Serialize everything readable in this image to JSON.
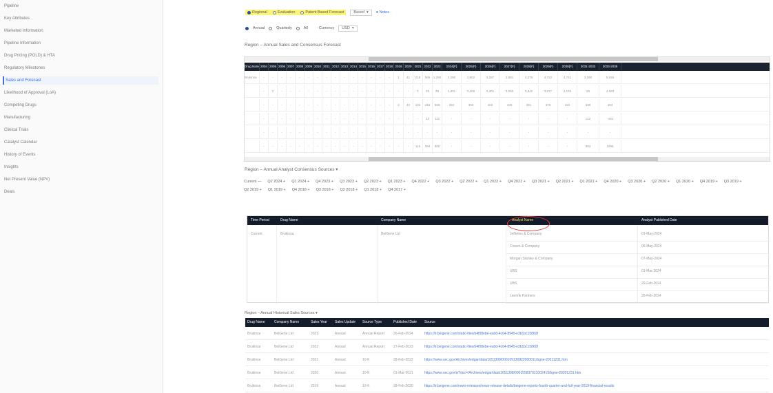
{
  "sidebar": {
    "items": [
      {
        "label": "Pipeline"
      },
      {
        "label": "Key Attributes"
      },
      {
        "label": "Marketed Information"
      },
      {
        "label": "Pipeline Information"
      },
      {
        "label": "Drug Pricing (POLD) & HTA"
      },
      {
        "label": "Regulatory Milestones"
      },
      {
        "label": "Sales and Forecast"
      },
      {
        "label": "Likelihood of Approval (LoA)"
      },
      {
        "label": "Competing Drugs"
      },
      {
        "label": "Manufacturing"
      },
      {
        "label": "Clinical Trials"
      },
      {
        "label": "Catalyst Calendar"
      },
      {
        "label": "History of Events"
      },
      {
        "label": "Insights"
      },
      {
        "label": "Net Present Value (NPV)"
      },
      {
        "label": "Deals"
      }
    ],
    "active_index": 6
  },
  "toolbar": {
    "regional": "Regional",
    "evaluation": "Evaluation",
    "patent": "Patent Based Forecast",
    "currency_select": "Based",
    "notes": "Notes"
  },
  "subtoolbar": {
    "annual": "Annual",
    "quarterly": "Quarterly",
    "all": "All",
    "currency_label": "Currency",
    "currency_value": "USD"
  },
  "forecast": {
    "title": "Region – Annual Sales and Consensus Forecast",
    "columns": [
      "Drug Name",
      "2004",
      "2005",
      "2006",
      "2007",
      "2008",
      "2009",
      "2010",
      "2011",
      "2012",
      "2013",
      "2014",
      "2015",
      "2016",
      "2017",
      "2018",
      "2019",
      "2020",
      "2021",
      "2022",
      "2023",
      "2024(F)",
      "2025(F)",
      "2026(F)",
      "2027(F)",
      "2028(F)",
      "2029(F)",
      "2030(F)",
      "2031-2033",
      "2033-2038"
    ],
    "rows": [
      [
        "Brukinsa",
        "-",
        "-",
        "-",
        "-",
        "-",
        "-",
        "-",
        "-",
        "-",
        "-",
        "-",
        "-",
        "-",
        "-",
        "-",
        "1",
        "41",
        "218",
        "565",
        "1,290",
        "2,290",
        "2,802",
        "3,297",
        "3,891",
        "4,279",
        "4,722",
        "4,741",
        "3,390",
        "5,626"
      ],
      [
        "",
        "-",
        "1",
        "-",
        "-",
        "-",
        "-",
        "-",
        "-",
        "-",
        "-",
        "-",
        "-",
        "-",
        "-",
        "-",
        "-",
        "-",
        "1",
        "19",
        "29",
        "1,831",
        "2,309",
        "2,301",
        "3,292",
        "3,841",
        "3,977",
        "4,133",
        "29",
        "4,093"
      ],
      [
        "",
        "-",
        "-",
        "-",
        "-",
        "-",
        "-",
        "-",
        "-",
        "-",
        "-",
        "-",
        "-",
        "-",
        "-",
        "-",
        "2",
        "40",
        "102",
        "316",
        "558",
        "294",
        "393",
        "402",
        "430",
        "391",
        "376",
        "422",
        "338",
        "403"
      ],
      [
        "",
        "-",
        "-",
        "-",
        "-",
        "-",
        "-",
        "-",
        "-",
        "-",
        "-",
        "-",
        "-",
        "-",
        "-",
        "-",
        "-",
        "-",
        "-",
        "13",
        "112",
        "-",
        "-",
        "-",
        "-",
        "-",
        "-",
        "-",
        "122",
        "-402"
      ],
      [
        "",
        "-",
        "-",
        "-",
        "-",
        "-",
        "-",
        "-",
        "-",
        "-",
        "-",
        "-",
        "-",
        "-",
        "-",
        "-",
        "-",
        "-",
        "-",
        "-",
        "-",
        "-",
        "-",
        "-",
        "-",
        "-",
        "-",
        "-",
        "-",
        "-"
      ],
      [
        "",
        "-",
        "-",
        "-",
        "-",
        "-",
        "-",
        "-",
        "-",
        "-",
        "-",
        "-",
        "-",
        "-",
        "-",
        "-",
        "-",
        "-",
        "116",
        "394",
        "900",
        "-",
        "-",
        "-",
        "-",
        "-",
        "-",
        "-",
        "993",
        "1998"
      ]
    ]
  },
  "consensus": {
    "title": "Region – Annual Analyst Consensus Sources",
    "tags": [
      "Current",
      "Q2 2024",
      "Q1 2024",
      "Q4 2023",
      "Q3 2023",
      "Q2 2023",
      "Q1 2023",
      "Q4 2022",
      "Q3 2022",
      "Q2 2022",
      "Q1 2022",
      "Q4 2021",
      "Q3 2021",
      "Q2 2021",
      "Q1 2021",
      "Q4 2020",
      "Q3 2020",
      "Q2 2020",
      "Q1 2020",
      "Q4 2019",
      "Q3 2019",
      "Q2 2019",
      "Q1 2019",
      "Q4 2018",
      "Q3 2018",
      "Q2 2018",
      "Q1 2018",
      "Q4 2017"
    ],
    "headers": {
      "time_period": "Time Period",
      "drug_name": "Drug Name",
      "company_name": "Company Name",
      "analyst_name": "Analyst Name",
      "published_date": "Analyst Published Date"
    },
    "time_period": "Current",
    "drug_name": "Brukinsa",
    "company_name": "BeiGene Ltd",
    "analysts": [
      {
        "name": "Jefferies & Company",
        "date": "01-May-2024"
      },
      {
        "name": "Cowen & Company",
        "date": "06-May-2024"
      },
      {
        "name": "Morgan Stanley & Company",
        "date": "07-May-2024"
      },
      {
        "name": "UBS",
        "date": "01-Mar-2024"
      },
      {
        "name": "UBS",
        "date": "29-Feb-2024"
      },
      {
        "name": "Leerink Partners",
        "date": "26-Feb-2024"
      }
    ]
  },
  "historical": {
    "title": "Region – Annual Historical Sales Sources",
    "headers": [
      "Drug Name",
      "Company Name",
      "Sales Year",
      "Sales Update",
      "Source Type",
      "Published Date",
      "Source"
    ],
    "rows": [
      [
        "Brukinsa",
        "BeiGene Ltd",
        "2023",
        "Annual",
        "Annual Report",
        "26-Feb-2024",
        "https://ir.beigene.com/static-files/b4f08ebe-ea0d-4c64-8945-e3b1bc15860f"
      ],
      [
        "Brukinsa",
        "BeiGene Ltd",
        "2022",
        "Annual",
        "Annual Report",
        "27-Feb-2023",
        "https://ir.beigene.com/static-files/b4f08ebe-ea0d-4c64-8945-e3b1bc15860f"
      ],
      [
        "Brukinsa",
        "BeiGene Ltd",
        "2021",
        "Annual",
        "10-K",
        "28-Feb-2022",
        "https://www.sec.gov/Archives/edgar/data/1651308/000165130822000011/bgne-20211231.htm"
      ],
      [
        "Brukinsa",
        "BeiGene Ltd",
        "2020",
        "Annual",
        "10-K",
        "01-Mar-2021",
        "https://www.sec.gov/ix?doc=/Archives/edgar/data/1651308/000155837021002415/bgne-20201231.htm"
      ],
      [
        "Brukinsa",
        "BeiGene Ltd",
        "2019",
        "Annual",
        "10-K",
        "28-Feb-2020",
        "https://ir.beigene.com/news-releases/news-release-details/beigene-reports-fourth-quarter-and-full-year-2019-financial-results"
      ]
    ]
  }
}
